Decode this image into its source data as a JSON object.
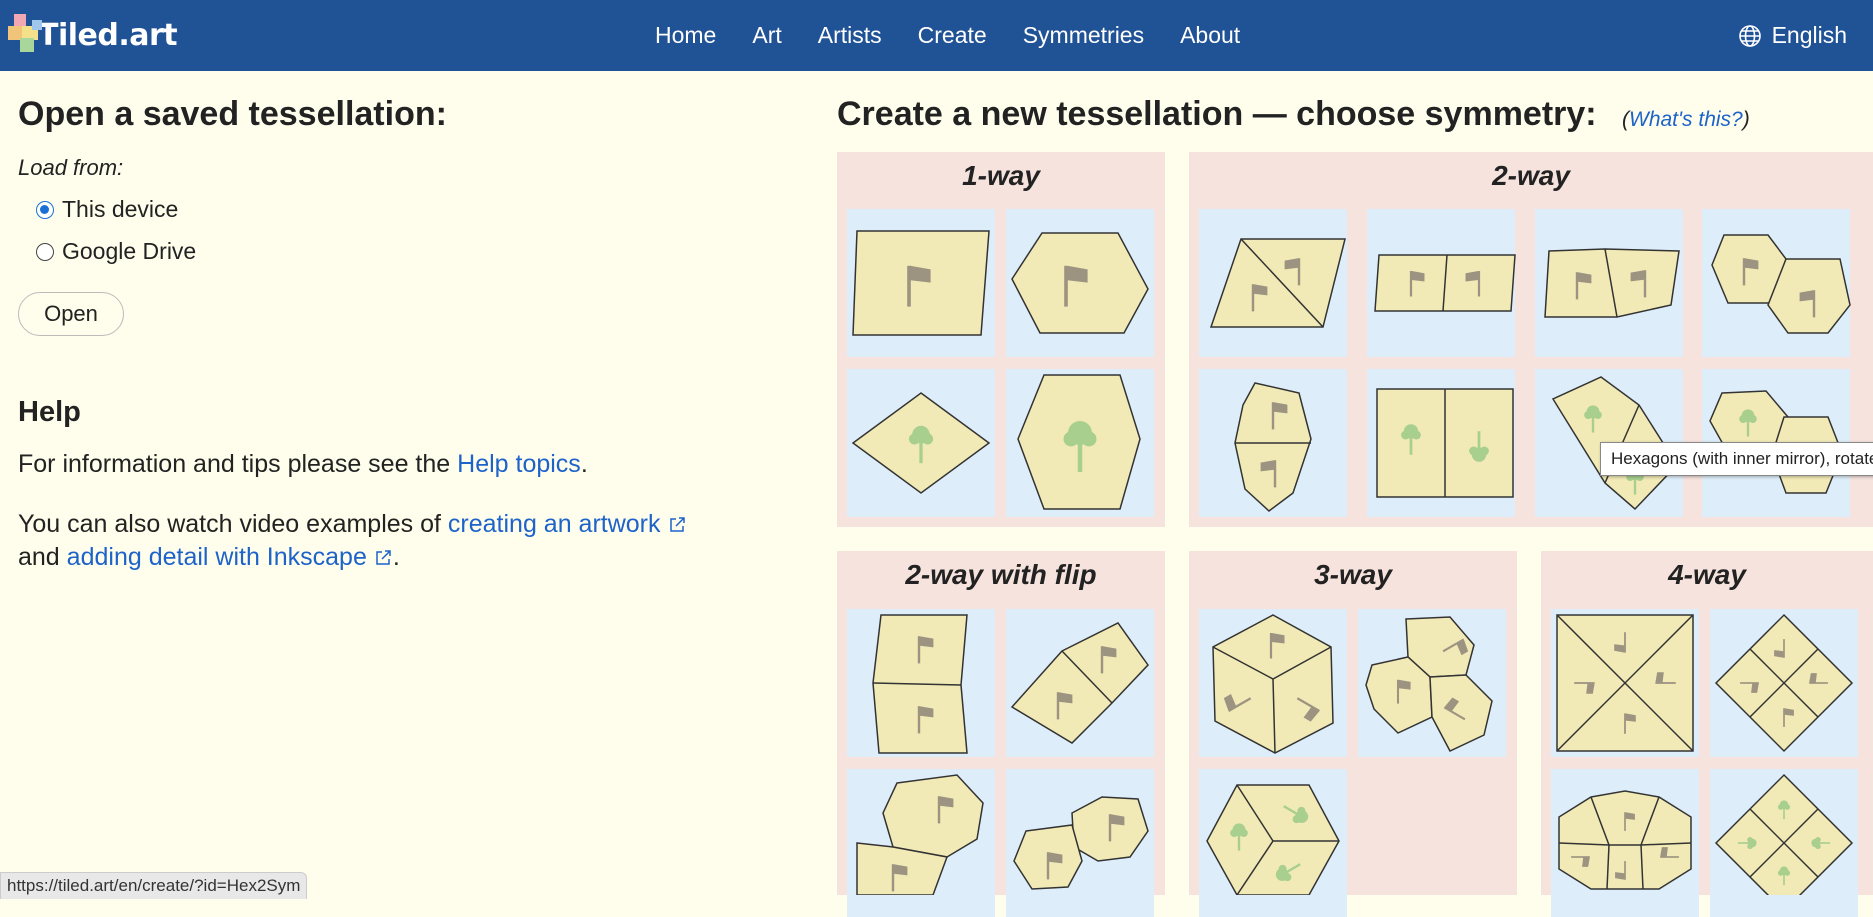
{
  "header": {
    "logo_text": "Tiled.art",
    "nav": [
      "Home",
      "Art",
      "Artists",
      "Create",
      "Symmetries",
      "About"
    ],
    "language": "English",
    "bar_color": "#205296"
  },
  "open_section": {
    "title": "Open a saved tessellation:",
    "load_from_label": "Load from:",
    "options": [
      {
        "label": "This device",
        "selected": true
      },
      {
        "label": "Google Drive",
        "selected": false
      }
    ],
    "open_button": "Open"
  },
  "help": {
    "title": "Help",
    "line1_prefix": "For information and tips please see the ",
    "line1_link": "Help topics",
    "line1_suffix": ".",
    "line2_prefix": "You can also watch video examples of ",
    "line2_link1": "creating an artwork",
    "line2_mid": "and ",
    "line2_link2": "adding detail with Inkscape",
    "line2_suffix": "."
  },
  "create_section": {
    "title": "Create a new tessellation — choose symmetry:",
    "whats_this_open": "(",
    "whats_this": "What's this?",
    "whats_this_close": ")",
    "groups": [
      {
        "title": "1-way",
        "tiles": [
          "parallelogram-flag",
          "hexagon-flag",
          "rhombus-tree",
          "hexagon-tree"
        ]
      },
      {
        "title": "2-way",
        "tiles": [
          "triangles-flag",
          "rect-pair-flag",
          "quad-pair-flag",
          "pentagon-pair-flag",
          "hexagon-split-flag",
          "rect-pair-tree",
          "rhombus-mirror-tree",
          "hexagon-mirror-tree"
        ]
      },
      {
        "title": "2-way with flip",
        "tiles": [
          "quad-stack-flag",
          "rhombus-pair-flag",
          "pentagon-pair-flag",
          "pentagon-row-flag"
        ]
      },
      {
        "title": "3-way",
        "tiles": [
          "hexagon-cube-flag",
          "pentagon-trio-flag",
          "hexagon-cube-tree"
        ]
      },
      {
        "title": "4-way",
        "tiles": [
          "square-x-flag",
          "diamond-quad-flag",
          "pentagon-ring-flag",
          "diamond-quad-tree"
        ]
      }
    ],
    "tile_bg": "#ddeefa",
    "panel_bg": "#f6e3de",
    "shape_fill": "#f2eab6"
  },
  "tooltip": "Hexagons (with inner mirror), rotate",
  "status_url": "https://tiled.art/en/create/?id=Hex2Sym"
}
